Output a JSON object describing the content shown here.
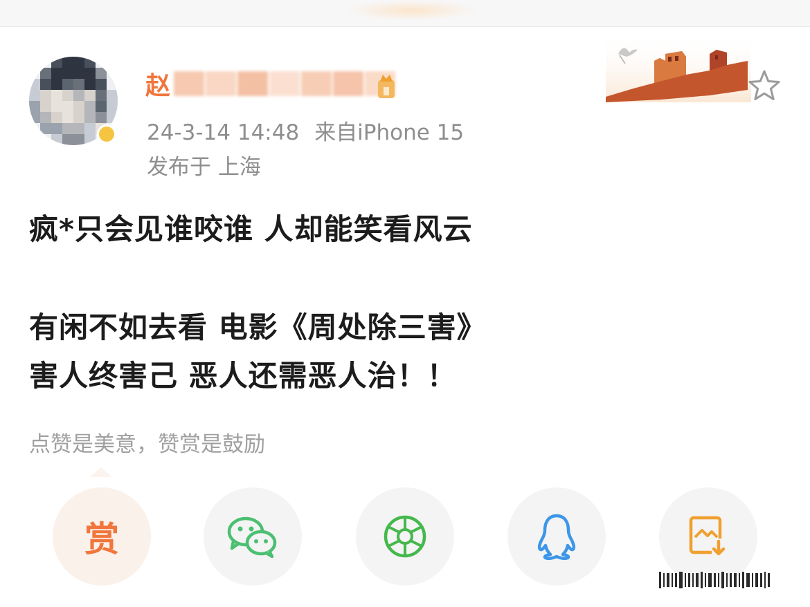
{
  "post": {
    "author": {
      "name_visible_char": "赵",
      "blurred": true
    },
    "timestamp": "24-3-14 14:48",
    "source": "来自iPhone 15",
    "location": "发布于 上海",
    "content": {
      "line1": "疯*只会见谁咬谁 人却能笑看风云",
      "line2": "有闲不如去看 电影《周处除三害》",
      "line3": "害人终害己 恶人还需恶人治！！"
    }
  },
  "reward": {
    "hint": "点赞是美意，赞赏是鼓励",
    "button_label": "赏"
  },
  "share": {
    "items": [
      {
        "icon": "reward-icon"
      },
      {
        "icon": "wechat-icon"
      },
      {
        "icon": "moments-icon"
      },
      {
        "icon": "qq-icon"
      },
      {
        "icon": "save-image-icon"
      }
    ]
  },
  "colors": {
    "accent": "#f0763c",
    "wechat": "#4cbf72",
    "moments": "#45b84b",
    "qq": "#3d96e8",
    "save": "#f0a030",
    "meta_text": "#8e8e8e"
  }
}
